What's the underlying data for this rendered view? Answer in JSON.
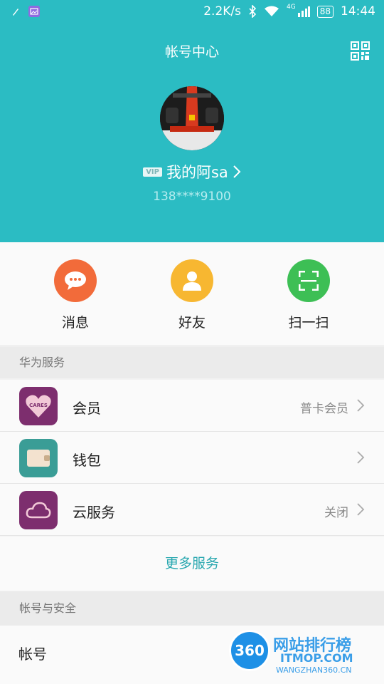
{
  "status_bar": {
    "net_speed": "2.2K/s",
    "signal_type": "4G",
    "battery": "88",
    "time": "14:44"
  },
  "header": {
    "title": "帐号中心",
    "vip_badge": "VIP",
    "username": "我的阿sa",
    "phone": "138****9100"
  },
  "quick_actions": [
    {
      "label": "消息",
      "color": "#f26b3a",
      "icon": "message-bubble-icon"
    },
    {
      "label": "好友",
      "color": "#f7b731",
      "icon": "person-icon"
    },
    {
      "label": "扫一扫",
      "color": "#3dbf55",
      "icon": "scan-frame-icon"
    }
  ],
  "huawei_services": {
    "section_title": "华为服务",
    "items": [
      {
        "label": "会员",
        "value": "普卡会员",
        "icon_text": "CARES",
        "color": "#7d2e6e"
      },
      {
        "label": "钱包",
        "value": "",
        "color": "#3a9d96"
      },
      {
        "label": "云服务",
        "value": "关闭",
        "color": "#7d2e6e"
      }
    ],
    "more": "更多服务"
  },
  "account_security": {
    "section_title": "帐号与安全",
    "items": [
      {
        "label": "帐号"
      }
    ]
  },
  "watermark": {
    "badge": "360",
    "name": "网站排行榜",
    "domain": "ITMOP.COM",
    "sub": "WANGZHAN360.CN"
  }
}
